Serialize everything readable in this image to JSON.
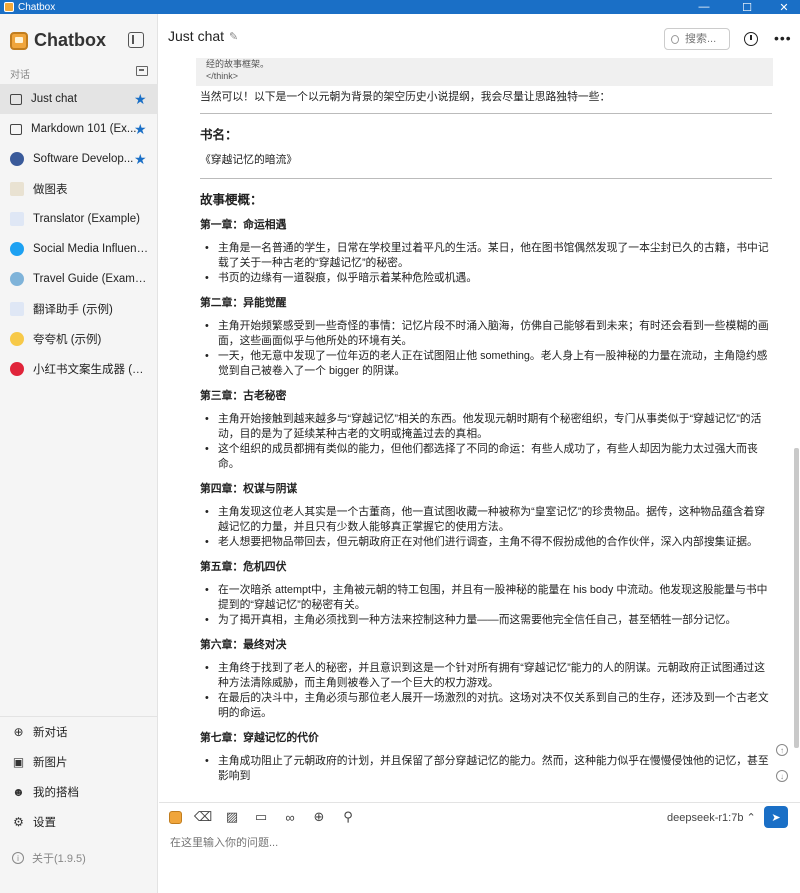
{
  "window": {
    "title": "Chatbox",
    "minimize": "—",
    "maximize": "☐",
    "close": "✕"
  },
  "sidebar": {
    "brand": "Chatbox",
    "section_label": "对话",
    "conversations": [
      {
        "label": "Just chat",
        "icon": "chat-bubble-icon",
        "starred": true,
        "active": true
      },
      {
        "label": "Markdown 101 (Ex...",
        "icon": "chat-bubble-icon",
        "starred": true
      },
      {
        "label": "Software Develop...",
        "icon": "developer-avatar-icon",
        "starred": true
      },
      {
        "label": "做图表",
        "icon": "chart-avatar-icon"
      },
      {
        "label": "Translator (Example)",
        "icon": "translator-avatar-icon"
      },
      {
        "label": "Social Media Influencer ...",
        "icon": "twitter-avatar-icon"
      },
      {
        "label": "Travel Guide (Example)",
        "icon": "globe-avatar-icon"
      },
      {
        "label": "翻译助手 (示例)",
        "icon": "translator-avatar-icon"
      },
      {
        "label": "夸夸机 (示例)",
        "icon": "sparkle-avatar-icon"
      },
      {
        "label": "小红书文案生成器 (示例)",
        "icon": "xiaohongshu-avatar-icon"
      }
    ],
    "star_glyph": "★",
    "bottom": {
      "new_chat": "新对话",
      "new_image": "新图片",
      "my_partners": "我的搭档",
      "settings": "设置"
    },
    "version": "关于(1.9.5)"
  },
  "header": {
    "title": "Just chat",
    "search_placeholder": "搜索..."
  },
  "message": {
    "think_line1": "经的故事框架。",
    "think_line2": "</think>",
    "intro": "当然可以！以下是一个以元朝为背景的架空历史小说提纲，我会尽量让思路独特一些：",
    "book_heading": "书名：",
    "book_title": "《穿越记忆的暗流》",
    "summary_heading": "故事梗概：",
    "chapters": [
      {
        "title": "第一章：命运相遇",
        "points": [
          "主角是一名普通的学生，日常在学校里过着平凡的生活。某日，他在图书馆偶然发现了一本尘封已久的古籍，书中记载了关于一种古老的“穿越记忆”的秘密。",
          "书页的边缘有一道裂痕，似乎暗示着某种危险或机遇。"
        ]
      },
      {
        "title": "第二章：异能觉醒",
        "points": [
          "主角开始频繁感受到一些奇怪的事情：记忆片段不时涌入脑海，仿佛自己能够看到未来；有时还会看到一些模糊的画面，这些画面似乎与他所处的环境有关。",
          "一天，他无意中发现了一位年迈的老人正在试图阻止他 something。老人身上有一股神秘的力量在流动，主角隐约感觉到自己被卷入了一个 bigger 的阴谋。"
        ]
      },
      {
        "title": "第三章：古老秘密",
        "points": [
          "主角开始接触到越来越多与“穿越记忆”相关的东西。他发现元朝时期有个秘密组织，专门从事类似于“穿越记忆”的活动，目的是为了延续某种古老的文明或掩盖过去的真相。",
          "这个组织的成员都拥有类似的能力，但他们都选择了不同的命运：有些人成功了，有些人却因为能力太过强大而丧命。"
        ]
      },
      {
        "title": "第四章：权谋与阴谋",
        "points": [
          "主角发现这位老人其实是一个古董商，他一直试图收藏一种被称为“皇室记忆”的珍贵物品。据传，这种物品蕴含着穿越记忆的力量，并且只有少数人能够真正掌握它的使用方法。",
          "老人想要把物品带回去，但元朝政府正在对他们进行调查，主角不得不假扮成他的合作伙伴，深入内部搜集证据。"
        ]
      },
      {
        "title": "第五章：危机四伏",
        "points": [
          "在一次暗杀 attempt中，主角被元朝的特工包围，并且有一股神秘的能量在 his body 中流动。他发现这股能量与书中提到的“穿越记忆”的秘密有关。",
          "为了揭开真相，主角必须找到一种方法来控制这种力量——而这需要他完全信任自己，甚至牺牲一部分记忆。"
        ]
      },
      {
        "title": "第六章：最终对决",
        "points": [
          "主角终于找到了老人的秘密，并且意识到这是一个针对所有拥有“穿越记忆”能力的人的阴谋。元朝政府正试图通过这种方法清除威胁，而主角则被卷入了一个巨大的权力游戏。",
          "在最后的决斗中，主角必须与那位老人展开一场激烈的对抗。这场对决不仅关系到自己的生存，还涉及到一个古老文明的命运。"
        ]
      },
      {
        "title": "第七章：穿越记忆的代价",
        "points": [
          "主角成功阻止了元朝政府的计划，并且保留了部分穿越记忆的能力。然而，这种能力似乎在慢慢侵蚀他的记忆，甚至影响到"
        ]
      }
    ]
  },
  "composer": {
    "model": "deepseek-r1:7b ⌃",
    "placeholder": "在这里输入你的问题..."
  },
  "colors": {
    "accent": "#1a6fc6",
    "sidebar_bg": "#f5f5f5",
    "brand_orange": "#f0a53b"
  }
}
